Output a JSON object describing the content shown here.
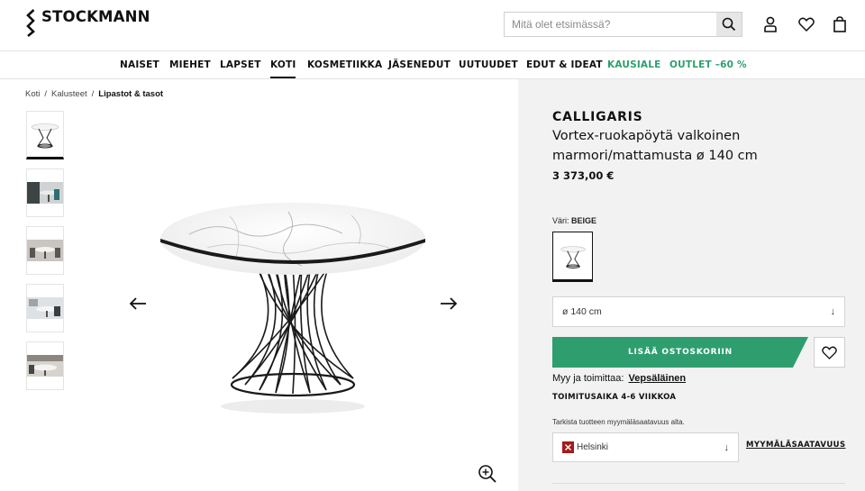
{
  "header": {
    "logo_text": "STOCKMANN",
    "search_placeholder": "Mitä olet etsimässä?",
    "icons": [
      "search-icon",
      "user-icon",
      "heart-icon",
      "shopping-bag-icon"
    ]
  },
  "nav": {
    "items": [
      {
        "label": "NAISET"
      },
      {
        "label": "MIEHET"
      },
      {
        "label": "LAPSET"
      },
      {
        "label": "KOTI"
      },
      {
        "label": "KOSMETIIKKA"
      },
      {
        "label": "JÄSENEDUT"
      },
      {
        "label": "UUTUUDET"
      },
      {
        "label": "EDUT & IDEAT"
      },
      {
        "label": "KAUSIALE"
      },
      {
        "label": "OUTLET –60 %"
      }
    ],
    "active_label": "KOTI",
    "highlight_color": "#2e9e6f"
  },
  "breadcrumb": {
    "items": [
      "Koti",
      "Kalusteet"
    ],
    "separator": "/",
    "current": "Lipastot & tasot"
  },
  "gallery": {
    "thumbnail_count": 5,
    "active_index": 0,
    "icons": [
      "arrow-left-icon",
      "arrow-right-icon",
      "zoom-in-icon"
    ]
  },
  "product": {
    "brand": "CALLIGARIS",
    "name": "Vortex-ruokapöytä valkoinen marmori/mattamusta ø 140 cm",
    "price": "3 373,00 €",
    "color_label": "Väri:",
    "color_value": "BEIGE",
    "size_value": "ø 140 cm",
    "add_to_cart": "LISÄÄ OSTOSKORIIN",
    "seller_label": "Myy ja toimittaa:",
    "seller_name": "Vepsäläinen",
    "delivery_time": "TOIMITUSAIKA 4-6 VIIKKOA",
    "availability_hint": "Tarkista tuotteen myymäläsaatavuus alta.",
    "store_value": "Helsinki",
    "store_availability_link": "MYYMÄLÄSAATAVUUS",
    "accent_color": "#2e9e6f",
    "panel_bg": "#f2f2f2"
  }
}
